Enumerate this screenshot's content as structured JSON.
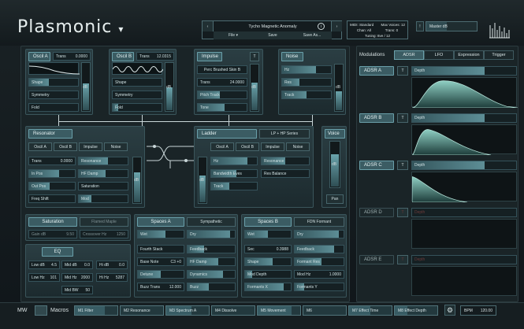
{
  "app": {
    "title": "Plasmonic",
    "bpm_label": "BPM",
    "bpm_value": "120.00",
    "mw_label": "MW"
  },
  "preset": {
    "name": "Tycho Magnetic Anomaly",
    "file": "File",
    "save": "Save",
    "save_as": "Save As..."
  },
  "midi": {
    "mode": "MIDI: Standard",
    "max_voices": "Max Voices: 12",
    "channel": "Chan: All",
    "trans": "Trans: 0",
    "tuning": "Tuning: 8ve / 12"
  },
  "master": {
    "label": "Master dB"
  },
  "osc_a": {
    "title": "Oscil A",
    "trans_label": "Trans",
    "trans_value": "0.0000",
    "shape": "Shape",
    "symmetry": "Symmetry",
    "fold": "Fold",
    "db": "dB"
  },
  "osc_b": {
    "title": "Oscil B",
    "trans_label": "Trans",
    "trans_value": "12.0315",
    "shape": "Shape",
    "symmetry": "Symmetry",
    "fold": "Fold",
    "db": "dB"
  },
  "impulse": {
    "title": "Impulse",
    "t": "T",
    "preset": "Perc Brushed Skin B",
    "trans_label": "Trans",
    "trans_value": "24.0000",
    "pitch_track": "Pitch Track",
    "tone": "Tone",
    "db": "dB"
  },
  "noise": {
    "title": "Noise",
    "hz": "Hz",
    "res": "Res",
    "track": "Track",
    "db": "dB"
  },
  "resonator": {
    "title": "Resonator",
    "sources": [
      "Oscil A",
      "Oscil B",
      "Impulse",
      "Noise"
    ],
    "trans_label": "Trans",
    "trans_value": "0.0000",
    "resonance": "Resonance",
    "in_pos": "In Pos",
    "hf_damp": "HF Damp",
    "out_pos": "Out Pos",
    "saturation": "Saturation",
    "freq_shift": "Freq Shift",
    "mod": "Mod",
    "db": "dB"
  },
  "ladder": {
    "title": "Ladder",
    "mode": "LP + HP Series",
    "sources": [
      "Oscil A",
      "Oscil B",
      "Impulse",
      "Noise"
    ],
    "hz": "Hz",
    "resonance": "Resonance",
    "bandwidth": "Bandwidth Eves",
    "res_balance": "Res Balance",
    "track": "Track",
    "db": "dB"
  },
  "voice": {
    "title": "Voice",
    "db": "dB",
    "pan": "Pan"
  },
  "saturation": {
    "title": "Saturation",
    "mode": "Flamed Maple",
    "gain_label": "Gain dB",
    "gain_value": "9.50",
    "crossover_label": "Crossover Hz",
    "crossover_value": "1250"
  },
  "eq": {
    "title": "EQ",
    "rows": [
      [
        {
          "l": "Low dB",
          "v": "4.5"
        },
        {
          "l": "Mid dB",
          "v": "0.0"
        },
        {
          "l": "Hi dB",
          "v": "0.0"
        }
      ],
      [
        {
          "l": "Low Hz",
          "v": "101"
        },
        {
          "l": "Mid Hz",
          "v": "2000"
        },
        {
          "l": "Hi Hz",
          "v": "5287"
        }
      ],
      [
        {
          "l": "Mid BW",
          "v": "50"
        }
      ]
    ]
  },
  "space_a": {
    "title": "Spaces A",
    "mode": "Sympathetic",
    "wet": "Wet",
    "dry": "Dry",
    "preset": "Fourth Stack",
    "feedback": "Feedback",
    "base_note_label": "Base Note",
    "base_note_value": "C3 +0",
    "hf_damp": "HF Damp",
    "detune": "Detune",
    "dynamics": "Dynamics",
    "buzz_trans_label": "Buzz Trans",
    "buzz_trans_value": "12.000",
    "buzz": "Buzz"
  },
  "space_b": {
    "title": "Spaces B",
    "mode": "FDN Formant",
    "wet": "Wet",
    "dry": "Dry",
    "sec_label": "Sec",
    "sec_value": "0.3988",
    "feedback": "Feedback",
    "shape": "Shape",
    "formant_res": "Formant Res",
    "mod_depth": "Mod Depth",
    "mod_hz_label": "Mod Hz",
    "mod_hz_value": "1.0000",
    "formants_x": "Formants X",
    "formants_y": "Formants Y"
  },
  "modulations": {
    "title": "Modulations",
    "tabs": [
      "ADSR",
      "LFO",
      "Expression",
      "Trigger"
    ],
    "adsr": [
      {
        "name": "ADSR A",
        "t": "T",
        "target": "Depth",
        "active": true
      },
      {
        "name": "ADSR B",
        "t": "T",
        "target": "Depth",
        "active": true
      },
      {
        "name": "ADSR C",
        "t": "T",
        "target": "Depth",
        "active": true
      },
      {
        "name": "ADSR D",
        "t": "T",
        "target": "Depth",
        "active": false
      },
      {
        "name": "ADSR E",
        "t": "T",
        "target": "Depth",
        "active": false
      }
    ]
  },
  "macros": {
    "title": "Macros",
    "items": [
      {
        "label": "M1 Filter",
        "fill": 0.7
      },
      {
        "label": "M2 Resonance",
        "fill": 0.0
      },
      {
        "label": "M3 Spectrum A",
        "fill": 0.6
      },
      {
        "label": "M4 Dissolve",
        "fill": 0.0
      },
      {
        "label": "M5 Movement",
        "fill": 0.8
      },
      {
        "label": "M6",
        "fill": 0.0
      },
      {
        "label": "M7 Effect Time",
        "fill": 0.5
      },
      {
        "label": "M8 Effect Depth",
        "fill": 0.3
      }
    ]
  },
  "colors": {
    "accent": "#6aa0aa",
    "panel": "#2b3e43",
    "bg": "#10161a"
  }
}
